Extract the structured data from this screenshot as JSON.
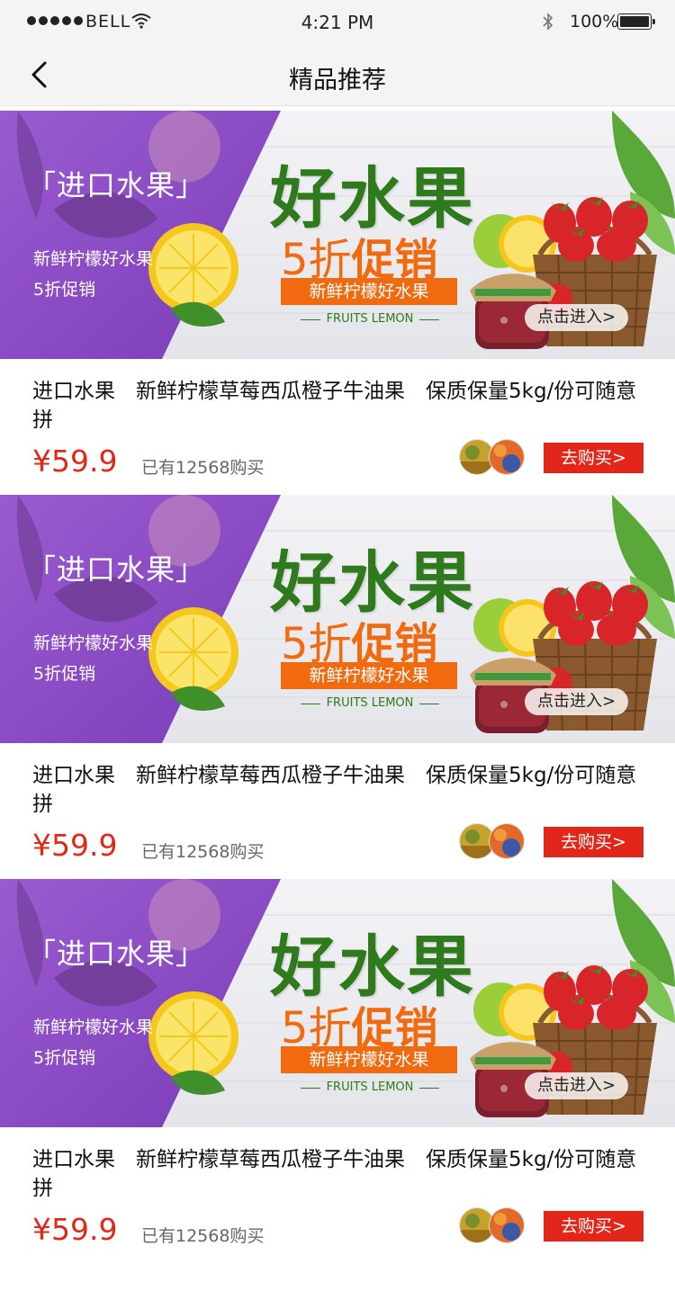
{
  "status_bar": {
    "carrier": "BELL",
    "time": "4:21 PM",
    "battery": "100%",
    "icons": [
      "signal-dots-icon",
      "wifi-icon",
      "bluetooth-icon",
      "battery-icon"
    ]
  },
  "nav": {
    "back_icon": "chevron-left-icon",
    "title": "精品推荐"
  },
  "colors": {
    "banner_purple": "#8a4bc4",
    "headline_green": "#2f7a1c",
    "accent_orange": "#f26a10",
    "price_red": "#e3261a"
  },
  "products": [
    {
      "banner": {
        "tag": "「进口水果」",
        "sub_line_1": "新鲜柠檬好水果",
        "sub_line_2": "5折促销",
        "headline": "好水果",
        "discount_num": "5折",
        "discount_word": "促销",
        "ribbon": "新鲜柠檬好水果",
        "english": "FRUITS LEMON",
        "enter_label": "点击进入>"
      },
      "title": "进口水果　新鲜柠檬草莓西瓜橙子牛油果　保质保量5kg/份可随意拼",
      "price": "¥59.9",
      "sold": "已有12568购买",
      "buy_label": "去购买>"
    },
    {
      "banner": {
        "tag": "「进口水果」",
        "sub_line_1": "新鲜柠檬好水果",
        "sub_line_2": "5折促销",
        "headline": "好水果",
        "discount_num": "5折",
        "discount_word": "促销",
        "ribbon": "新鲜柠檬好水果",
        "english": "FRUITS LEMON",
        "enter_label": "点击进入>"
      },
      "title": "进口水果　新鲜柠檬草莓西瓜橙子牛油果　保质保量5kg/份可随意拼",
      "price": "¥59.9",
      "sold": "已有12568购买",
      "buy_label": "去购买>"
    },
    {
      "banner": {
        "tag": "「进口水果」",
        "sub_line_1": "新鲜柠檬好水果",
        "sub_line_2": "5折促销",
        "headline": "好水果",
        "discount_num": "5折",
        "discount_word": "促销",
        "ribbon": "新鲜柠檬好水果",
        "english": "FRUITS LEMON",
        "enter_label": "点击进入>"
      },
      "title": "进口水果　新鲜柠檬草莓西瓜橙子牛油果　保质保量5kg/份可随意拼",
      "price": "¥59.9",
      "sold": "已有12568购买",
      "buy_label": "去购买>"
    }
  ]
}
